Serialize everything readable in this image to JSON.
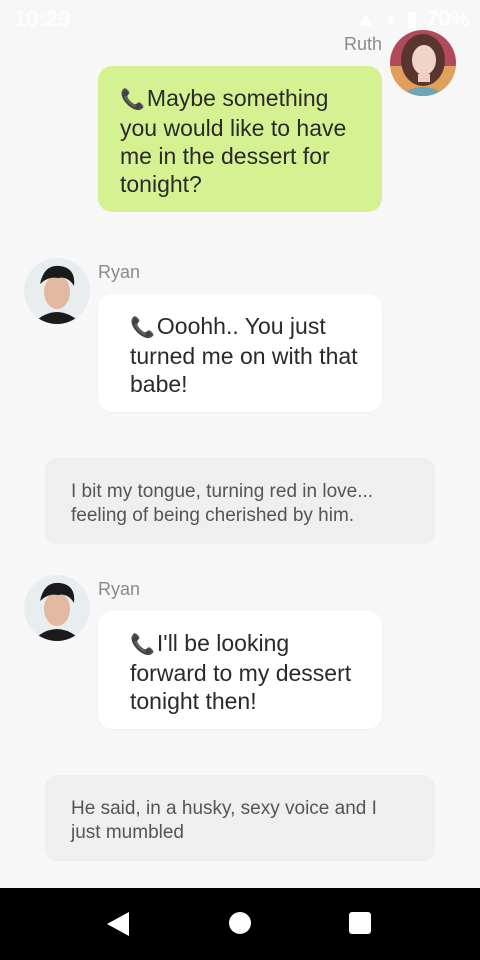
{
  "status_bar": {
    "time": "10:29",
    "battery": "70%"
  },
  "messages": [
    {
      "sender": "Ruth",
      "side": "right",
      "text": "Maybe something you would like to have me in the dessert for tonight?"
    },
    {
      "sender": "Ryan",
      "side": "left",
      "text": "Ooohh.. You just turned me on with that babe!"
    },
    {
      "narration": "I bit my tongue, turning red in love... feeling of being cherished by him."
    },
    {
      "sender": "Ryan",
      "side": "left",
      "text": "I'll be looking forward to my dessert tonight then!"
    },
    {
      "narration": "He said, in a husky, sexy voice and I just mumbled"
    }
  ],
  "icons": {
    "call": "phone-icon",
    "back": "back-triangle-icon",
    "home": "home-circle-icon",
    "recents": "recents-square-icon"
  }
}
